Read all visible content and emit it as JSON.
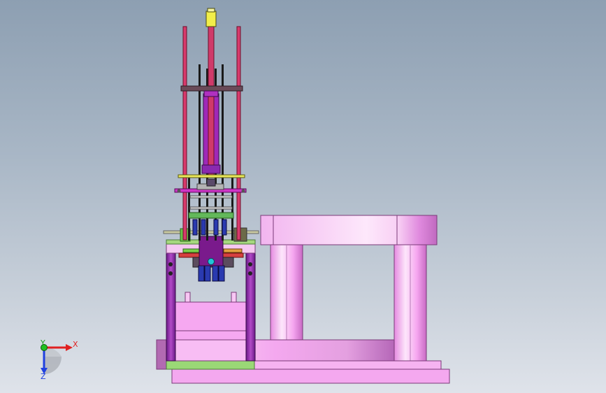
{
  "viewport": {
    "background_top": "#8d9fb2",
    "background_bottom": "#dfe3ea"
  },
  "triad": {
    "x_label": "X",
    "y_label": "Y",
    "z_label": "Z",
    "x_color": "#e02020",
    "y_color": "#20c020",
    "z_color": "#2040e0"
  },
  "colors": {
    "pink": "#f49ef0",
    "purple": "#8f2aa8",
    "red_rod": "#d23a6a",
    "green": "#8fd06a",
    "blue": "#2a3ab0",
    "dark_brown": "#5a3a48",
    "yellow": "#f2e84a"
  }
}
